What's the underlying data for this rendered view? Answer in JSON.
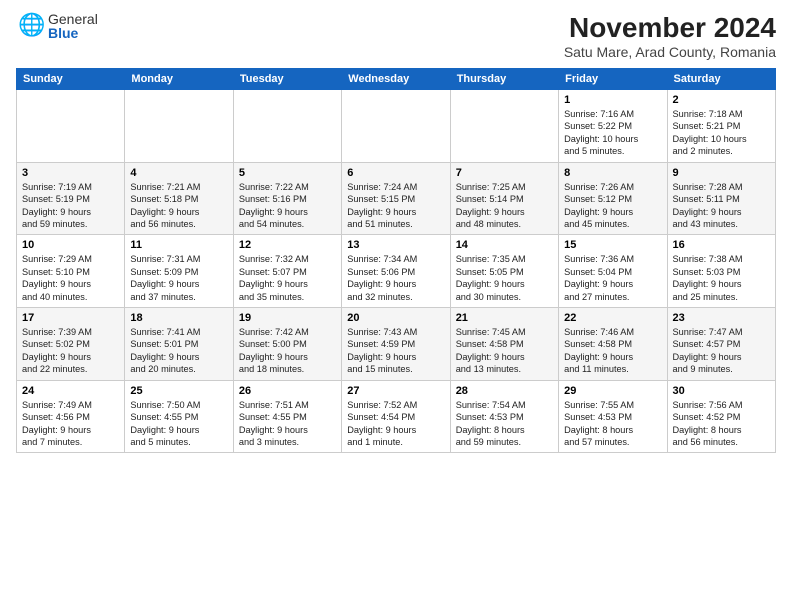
{
  "logo": {
    "general": "General",
    "blue": "Blue"
  },
  "title": "November 2024",
  "subtitle": "Satu Mare, Arad County, Romania",
  "weekdays": [
    "Sunday",
    "Monday",
    "Tuesday",
    "Wednesday",
    "Thursday",
    "Friday",
    "Saturday"
  ],
  "weeks": [
    [
      {
        "day": "",
        "info": ""
      },
      {
        "day": "",
        "info": ""
      },
      {
        "day": "",
        "info": ""
      },
      {
        "day": "",
        "info": ""
      },
      {
        "day": "",
        "info": ""
      },
      {
        "day": "1",
        "info": "Sunrise: 7:16 AM\nSunset: 5:22 PM\nDaylight: 10 hours\nand 5 minutes."
      },
      {
        "day": "2",
        "info": "Sunrise: 7:18 AM\nSunset: 5:21 PM\nDaylight: 10 hours\nand 2 minutes."
      }
    ],
    [
      {
        "day": "3",
        "info": "Sunrise: 7:19 AM\nSunset: 5:19 PM\nDaylight: 9 hours\nand 59 minutes."
      },
      {
        "day": "4",
        "info": "Sunrise: 7:21 AM\nSunset: 5:18 PM\nDaylight: 9 hours\nand 56 minutes."
      },
      {
        "day": "5",
        "info": "Sunrise: 7:22 AM\nSunset: 5:16 PM\nDaylight: 9 hours\nand 54 minutes."
      },
      {
        "day": "6",
        "info": "Sunrise: 7:24 AM\nSunset: 5:15 PM\nDaylight: 9 hours\nand 51 minutes."
      },
      {
        "day": "7",
        "info": "Sunrise: 7:25 AM\nSunset: 5:14 PM\nDaylight: 9 hours\nand 48 minutes."
      },
      {
        "day": "8",
        "info": "Sunrise: 7:26 AM\nSunset: 5:12 PM\nDaylight: 9 hours\nand 45 minutes."
      },
      {
        "day": "9",
        "info": "Sunrise: 7:28 AM\nSunset: 5:11 PM\nDaylight: 9 hours\nand 43 minutes."
      }
    ],
    [
      {
        "day": "10",
        "info": "Sunrise: 7:29 AM\nSunset: 5:10 PM\nDaylight: 9 hours\nand 40 minutes."
      },
      {
        "day": "11",
        "info": "Sunrise: 7:31 AM\nSunset: 5:09 PM\nDaylight: 9 hours\nand 37 minutes."
      },
      {
        "day": "12",
        "info": "Sunrise: 7:32 AM\nSunset: 5:07 PM\nDaylight: 9 hours\nand 35 minutes."
      },
      {
        "day": "13",
        "info": "Sunrise: 7:34 AM\nSunset: 5:06 PM\nDaylight: 9 hours\nand 32 minutes."
      },
      {
        "day": "14",
        "info": "Sunrise: 7:35 AM\nSunset: 5:05 PM\nDaylight: 9 hours\nand 30 minutes."
      },
      {
        "day": "15",
        "info": "Sunrise: 7:36 AM\nSunset: 5:04 PM\nDaylight: 9 hours\nand 27 minutes."
      },
      {
        "day": "16",
        "info": "Sunrise: 7:38 AM\nSunset: 5:03 PM\nDaylight: 9 hours\nand 25 minutes."
      }
    ],
    [
      {
        "day": "17",
        "info": "Sunrise: 7:39 AM\nSunset: 5:02 PM\nDaylight: 9 hours\nand 22 minutes."
      },
      {
        "day": "18",
        "info": "Sunrise: 7:41 AM\nSunset: 5:01 PM\nDaylight: 9 hours\nand 20 minutes."
      },
      {
        "day": "19",
        "info": "Sunrise: 7:42 AM\nSunset: 5:00 PM\nDaylight: 9 hours\nand 18 minutes."
      },
      {
        "day": "20",
        "info": "Sunrise: 7:43 AM\nSunset: 4:59 PM\nDaylight: 9 hours\nand 15 minutes."
      },
      {
        "day": "21",
        "info": "Sunrise: 7:45 AM\nSunset: 4:58 PM\nDaylight: 9 hours\nand 13 minutes."
      },
      {
        "day": "22",
        "info": "Sunrise: 7:46 AM\nSunset: 4:58 PM\nDaylight: 9 hours\nand 11 minutes."
      },
      {
        "day": "23",
        "info": "Sunrise: 7:47 AM\nSunset: 4:57 PM\nDaylight: 9 hours\nand 9 minutes."
      }
    ],
    [
      {
        "day": "24",
        "info": "Sunrise: 7:49 AM\nSunset: 4:56 PM\nDaylight: 9 hours\nand 7 minutes."
      },
      {
        "day": "25",
        "info": "Sunrise: 7:50 AM\nSunset: 4:55 PM\nDaylight: 9 hours\nand 5 minutes."
      },
      {
        "day": "26",
        "info": "Sunrise: 7:51 AM\nSunset: 4:55 PM\nDaylight: 9 hours\nand 3 minutes."
      },
      {
        "day": "27",
        "info": "Sunrise: 7:52 AM\nSunset: 4:54 PM\nDaylight: 9 hours\nand 1 minute."
      },
      {
        "day": "28",
        "info": "Sunrise: 7:54 AM\nSunset: 4:53 PM\nDaylight: 8 hours\nand 59 minutes."
      },
      {
        "day": "29",
        "info": "Sunrise: 7:55 AM\nSunset: 4:53 PM\nDaylight: 8 hours\nand 57 minutes."
      },
      {
        "day": "30",
        "info": "Sunrise: 7:56 AM\nSunset: 4:52 PM\nDaylight: 8 hours\nand 56 minutes."
      }
    ]
  ]
}
